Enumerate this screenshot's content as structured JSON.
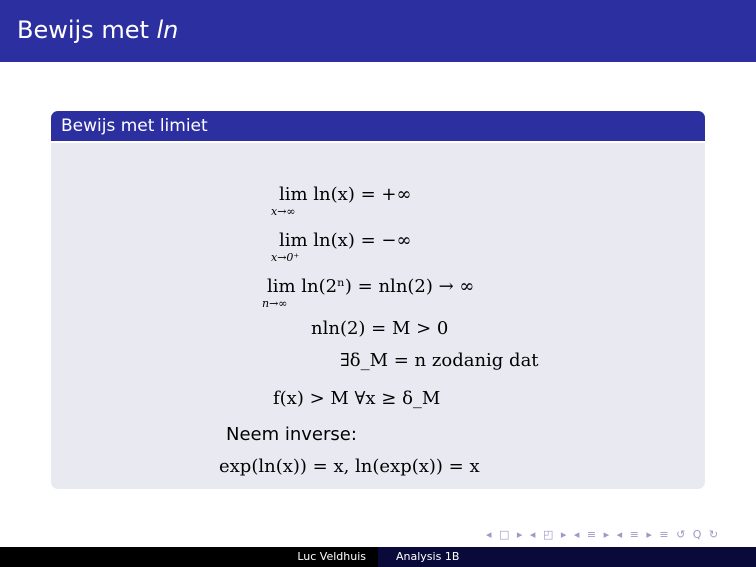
{
  "slide": {
    "title_main": "Bewijs met ",
    "title_italic": "ln"
  },
  "block": {
    "title": "Bewijs met limiet",
    "lines": {
      "l1": "lim ln(x) = +∞",
      "l1_sub": "x→∞",
      "l2": "lim ln(x) = −∞",
      "l2_sub": "x→0⁺",
      "l3": "lim ln(2ⁿ) = nln(2) → ∞",
      "l3_sub": "n→∞",
      "l4": "nln(2) = M > 0",
      "l5": "∃δ_M = n zodanig dat",
      "l6": "f(x) > M ∀x ≥ δ_M",
      "l7": "Neem inverse:",
      "l8": "exp(ln(x)) = x, ln(exp(x)) = x"
    }
  },
  "navigation": {
    "symbols": "◂ □ ▸ ◂ ◰ ▸ ◂ ≡ ▸ ◂ ≡ ▸  ≡  ↺ Q ↻"
  },
  "footer": {
    "author": "Luc Veldhuis",
    "course": "Analysis 1B"
  }
}
